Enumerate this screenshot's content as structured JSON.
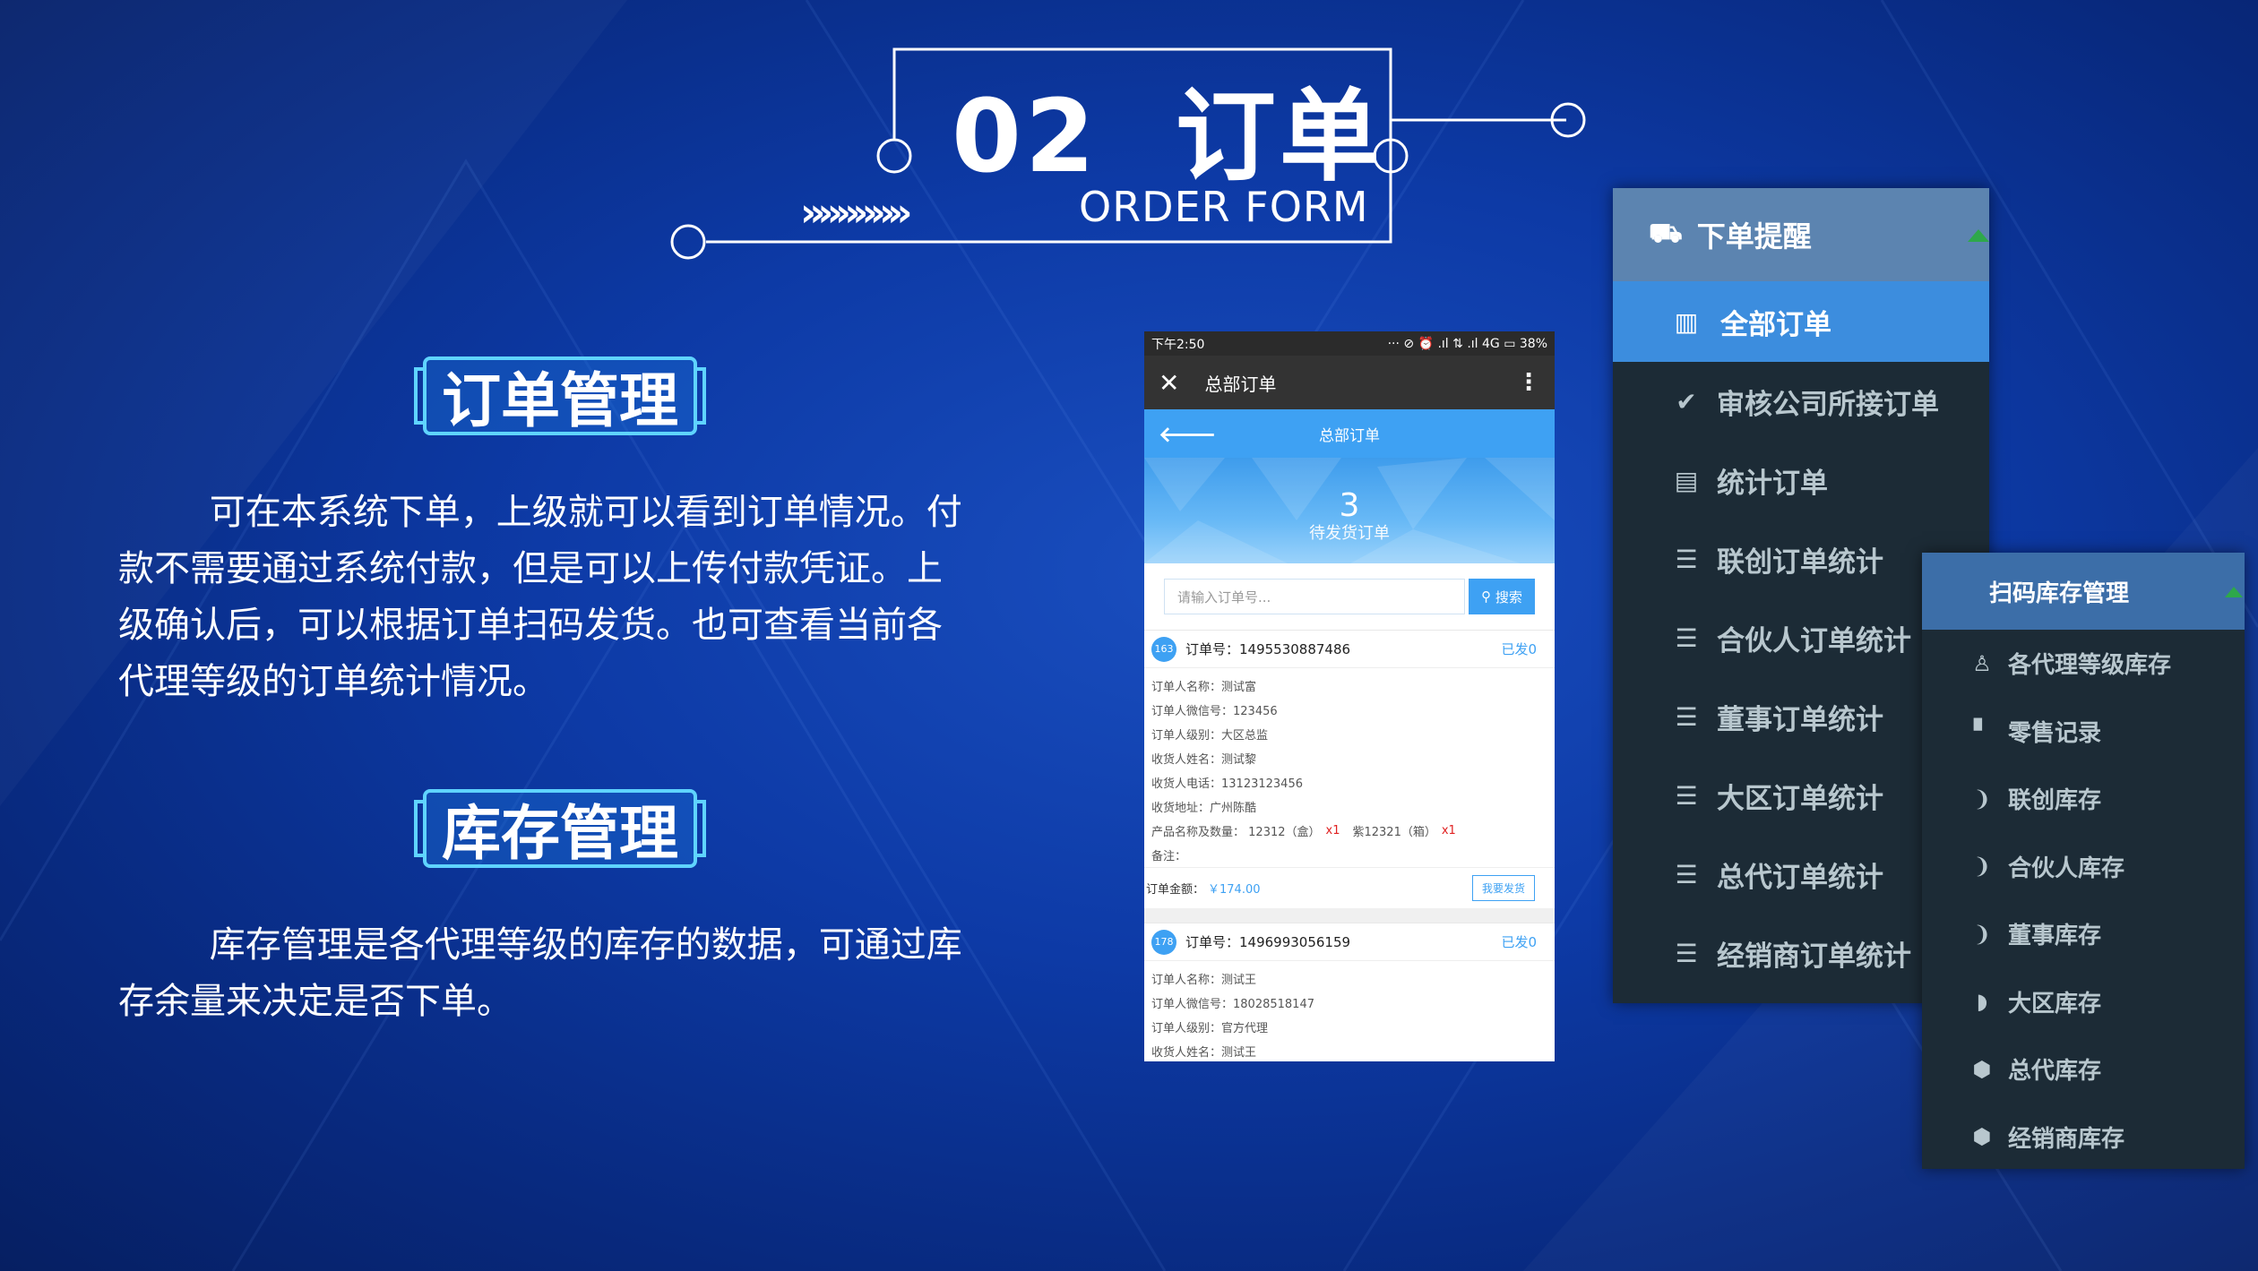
{
  "slide": {
    "title_number": "02",
    "title_text": "订单",
    "subtitle": "ORDER FORM",
    "chevrons": "»»»»»»"
  },
  "sections": {
    "order_mgmt": {
      "heading": "订单管理",
      "text": "        可在本系统下单，上级就可以看到订单情况。付\n款不需要通过系统付款，但是可以上传付款凭证。上\n级确认后，可以根据订单扫码发货。也可查看当前各\n代理等级的订单统计情况。"
    },
    "stock_mgmt": {
      "heading": "库存管理",
      "text": "        库存管理是各代理等级的库存的数据，可通过库\n存余量来决定是否下单。"
    }
  },
  "phone": {
    "status_time": "下午2:50",
    "status_right": "··· ⊘ ⏰ .ıl ⇅ .ıl 4G ▭ 38%",
    "wx_title": "总部订单",
    "page_title": "总部订单",
    "pending_count": "3",
    "pending_label": "待发货订单",
    "search_placeholder": "请输入订单号...",
    "search_button": "搜索",
    "orders": [
      {
        "badge": "163",
        "order_no": "订单号：1495530887486",
        "status": "已发0",
        "rows": [
          "订单人名称：测试富",
          "订单人微信号：123456",
          "订单人级别：大区总监",
          "收货人姓名：测试黎",
          "收货人电话：13123123456",
          "收货地址：广州陈酷"
        ],
        "product_label": "产品名称及数量：",
        "product_1": "12312（盒）",
        "qty_1": "x1",
        "product_2": "紫12321（箱）",
        "qty_2": "x1",
        "remark": "备注：",
        "amount_label": "订单金额：",
        "amount": "￥174.00",
        "ship_button": "我要发货"
      },
      {
        "badge": "178",
        "order_no": "订单号：1496993056159",
        "status": "已发0",
        "rows": [
          "订单人名称：测试王",
          "订单人微信号：18028518147",
          "订单人级别：官方代理",
          "收货人姓名：测试王"
        ]
      }
    ]
  },
  "menu_orders": {
    "header": "下单提醒",
    "items": [
      {
        "label": "全部订单",
        "icon": "bar-chart-icon",
        "glyph": "▥"
      },
      {
        "label": "审核公司所接订单",
        "icon": "check-circle-icon",
        "glyph": "✔"
      },
      {
        "label": "统计订单",
        "icon": "list-alt-icon",
        "glyph": "▤"
      },
      {
        "label": "联创订单统计",
        "icon": "list-icon",
        "glyph": "☰"
      },
      {
        "label": "合伙人订单统计",
        "icon": "list-icon",
        "glyph": "☰"
      },
      {
        "label": "董事订单统计",
        "icon": "list-icon",
        "glyph": "☰"
      },
      {
        "label": "大区订单统计",
        "icon": "list-icon",
        "glyph": "☰"
      },
      {
        "label": "总代订单统计",
        "icon": "list-icon",
        "glyph": "☰"
      },
      {
        "label": "经销商订单统计",
        "icon": "list-icon",
        "glyph": "☰"
      }
    ]
  },
  "menu_stock": {
    "header": "扫码库存管理",
    "items": [
      {
        "label": "各代理等级库存",
        "icon": "flask-icon",
        "glyph": "♙"
      },
      {
        "label": "零售记录",
        "icon": "doc-icon",
        "glyph": "▘"
      },
      {
        "label": "联创库存",
        "icon": "cube-icon",
        "glyph": "❩"
      },
      {
        "label": "合伙人库存",
        "icon": "cube-icon",
        "glyph": "❩"
      },
      {
        "label": "董事库存",
        "icon": "cube-icon",
        "glyph": "❩"
      },
      {
        "label": "大区库存",
        "icon": "cube-icon",
        "glyph": "◗"
      },
      {
        "label": "总代库存",
        "icon": "cube-icon",
        "glyph": "⬢"
      },
      {
        "label": "经销商库存",
        "icon": "cube-icon",
        "glyph": "⬢"
      }
    ]
  },
  "colors": {
    "bg": "#0d3aa6",
    "accent_blue": "#3ea1f3",
    "menu_dark": "#1c2b36",
    "menu_active": "#3c8dde",
    "heading_glow": "#3ec8ff"
  }
}
